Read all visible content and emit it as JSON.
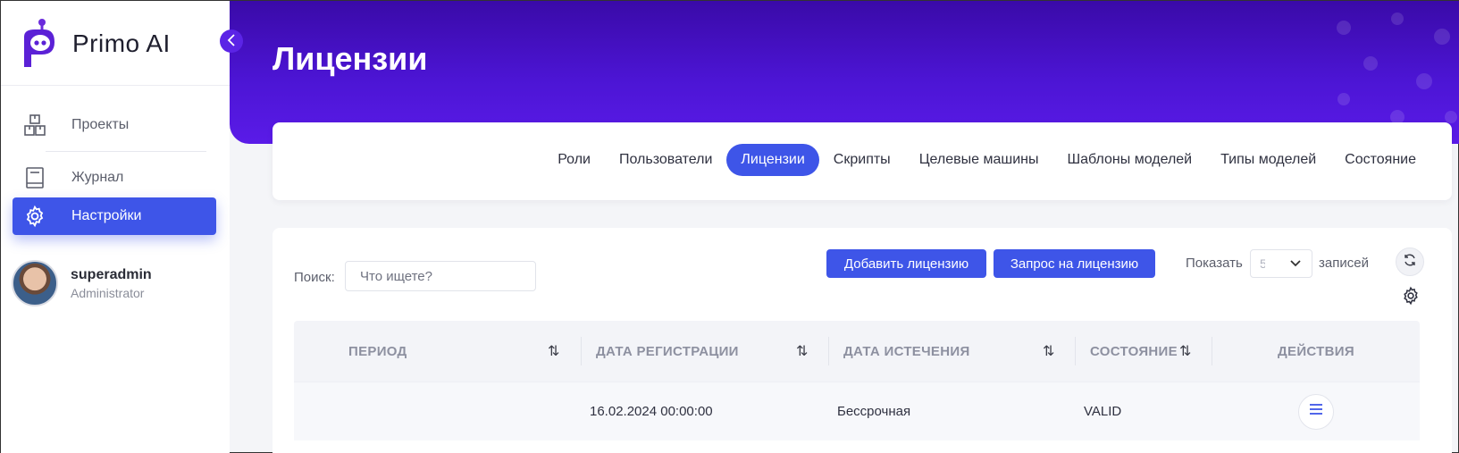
{
  "app": {
    "name": "Primo AI"
  },
  "sidebar": {
    "items": [
      {
        "label": "Проекты",
        "icon": "boxes-icon"
      },
      {
        "label": "Журнал",
        "icon": "book-icon"
      },
      {
        "label": "Настройки",
        "icon": "gear-icon",
        "active": true
      }
    ],
    "user": {
      "name": "superadmin",
      "role": "Administrator"
    }
  },
  "header": {
    "title": "Лицензии"
  },
  "tabs": [
    {
      "label": "Роли"
    },
    {
      "label": "Пользователи"
    },
    {
      "label": "Лицензии",
      "active": true
    },
    {
      "label": "Скрипты"
    },
    {
      "label": "Целевые машины"
    },
    {
      "label": "Шаблоны моделей"
    },
    {
      "label": "Типы моделей"
    },
    {
      "label": "Состояние"
    }
  ],
  "toolbar": {
    "search_label": "Поиск:",
    "search_placeholder": "Что ищете?",
    "add_license_label": "Добавить лицензию",
    "request_license_label": "Запрос на лицензию",
    "show_label": "Показать",
    "records_label": "записей",
    "page_size": "5"
  },
  "table": {
    "columns": [
      "Период",
      "Дата регистрации",
      "Дата истечения",
      "Состояние",
      "Действия"
    ],
    "rows": [
      {
        "period": "",
        "registered": "16.02.2024 00:00:00",
        "expires": "Бессрочная",
        "state": "VALID"
      }
    ]
  },
  "colors": {
    "accent": "#3e55e8",
    "banner": "#4c15d4"
  }
}
